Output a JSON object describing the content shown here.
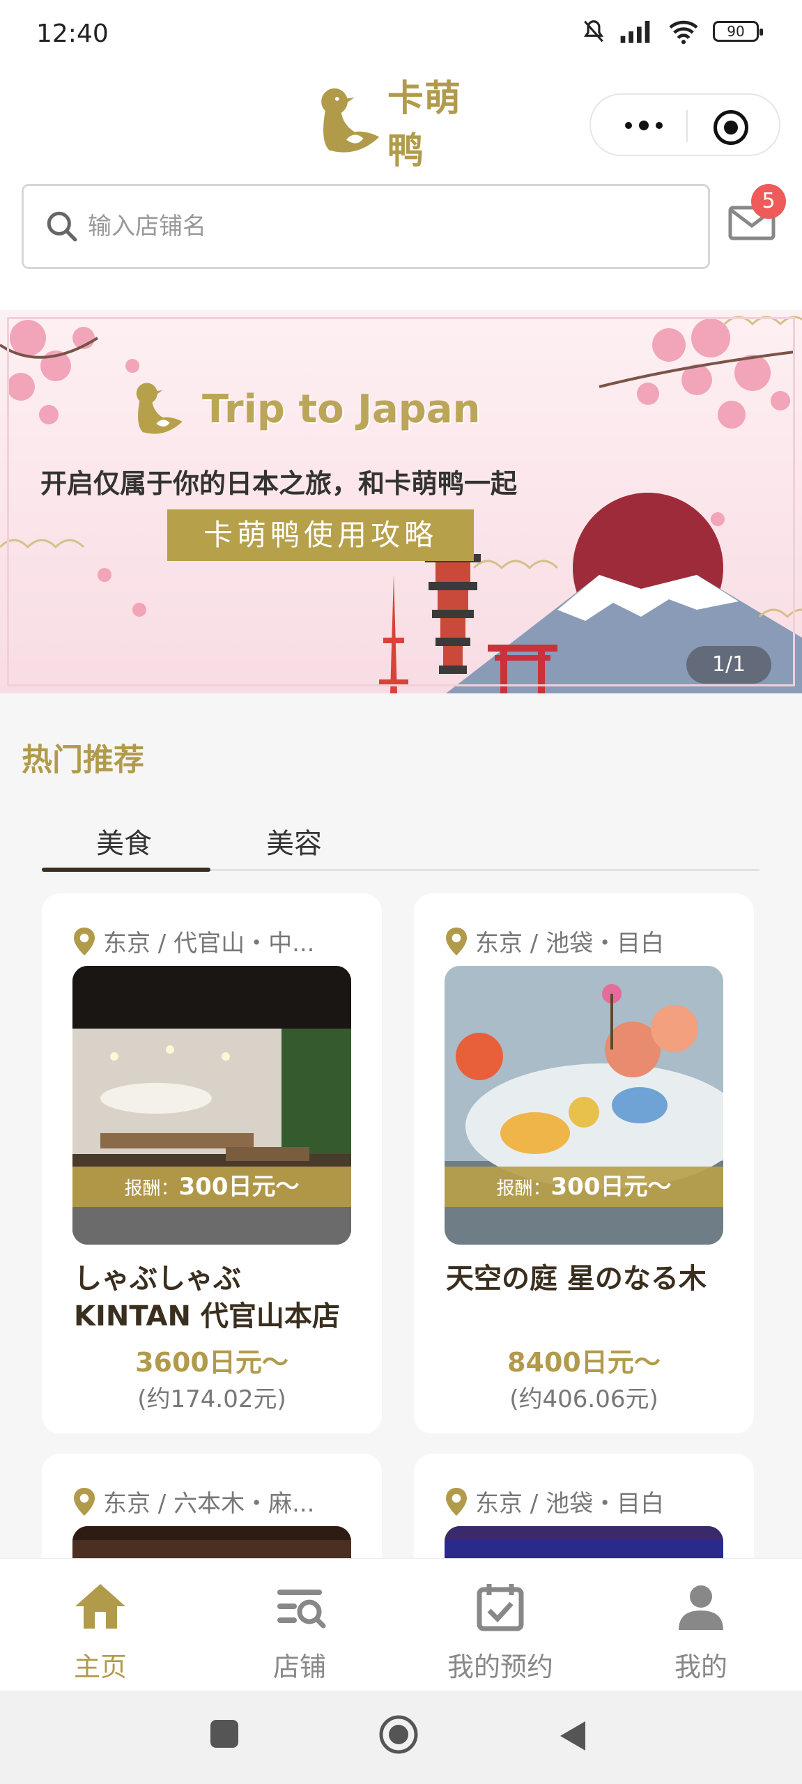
{
  "status_bar": {
    "time": "12:40",
    "battery": "90"
  },
  "header": {
    "logo_text": "卡萌鸭"
  },
  "search": {
    "placeholder": "输入店铺名",
    "value": ""
  },
  "messages": {
    "badge": "5"
  },
  "banner": {
    "title": "Trip to Japan",
    "subtitle": "开启仅属于你的日本之旅，和卡萌鸭一起",
    "button": "卡萌鸭使用攻略",
    "counter": "1/1"
  },
  "section": {
    "title": "热门推荐"
  },
  "tabs": [
    {
      "label": "美食",
      "active": true
    },
    {
      "label": "美容",
      "active": false
    }
  ],
  "cards": [
    {
      "location": "东京 / 代官山・中...",
      "reward_label": "报酬：",
      "reward_value": "300日元〜",
      "name": "しゃぶしゃぶ KINTAN 代官山本店",
      "price": "3600日元〜",
      "price_cny": "(约174.02元)"
    },
    {
      "location": "东京 / 池袋・目白",
      "reward_label": "报酬：",
      "reward_value": "300日元〜",
      "name": "天空の庭 星のなる木",
      "price": "8400日元〜",
      "price_cny": "(约406.06元)"
    },
    {
      "location": "东京 / 六本木・麻...",
      "reward_label": "",
      "reward_value": "",
      "name": "",
      "price": "",
      "price_cny": ""
    },
    {
      "location": "东京 / 池袋・目白",
      "reward_label": "",
      "reward_value": "",
      "name": "",
      "price": "",
      "price_cny": ""
    }
  ],
  "tabbar": [
    {
      "label": "主页",
      "icon": "home-icon",
      "active": true
    },
    {
      "label": "店铺",
      "icon": "store-search-icon",
      "active": false
    },
    {
      "label": "我的预约",
      "icon": "calendar-check-icon",
      "active": false
    },
    {
      "label": "我的",
      "icon": "user-icon",
      "active": false
    }
  ],
  "colors": {
    "accent": "#b19b4b",
    "dark": "#3a2e1e",
    "badge": "#ef5a5a"
  }
}
